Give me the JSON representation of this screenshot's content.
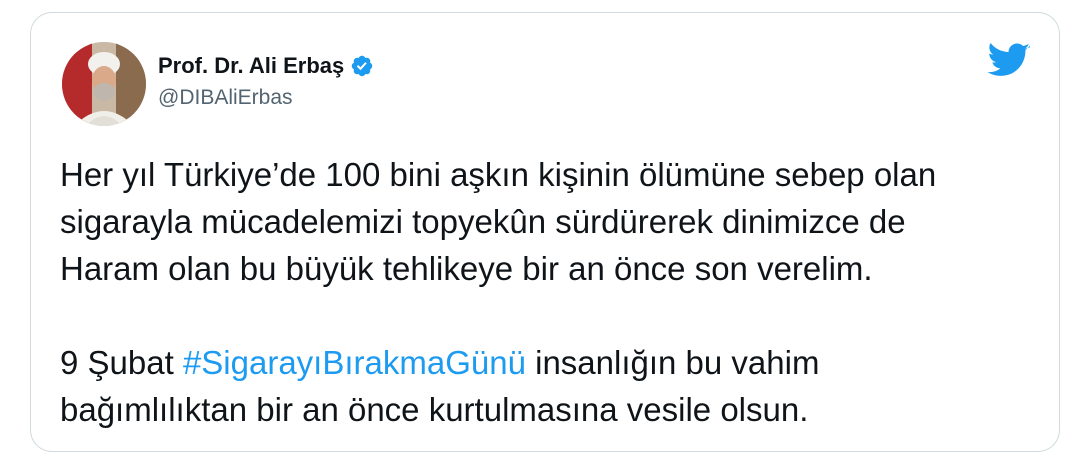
{
  "author": {
    "name": "Prof. Dr. Ali Erbaş",
    "handle": "@DIBAliErbas",
    "verified": true
  },
  "tweet": {
    "para1": [
      "Her yıl Türkiye’de 100 bini aşkın kişinin ölümüne sebep olan",
      "sigarayla mücadelemizi topyekûn sürdürerek dinimizce de",
      "Haram olan bu büyük tehlikeye bir an önce son verelim."
    ],
    "para2_prefix": "9 Şubat ",
    "hashtag": "#SigarayıBırakmaGünü",
    "para2_suffix": " insanlığın bu vahim",
    "para2_line2": "bağımlılıktan bir an önce kurtulmasına vesile olsun."
  },
  "icons": {
    "brand": "twitter-bird-icon",
    "verified": "verified-badge-icon"
  },
  "colors": {
    "accent": "#1d9bf0",
    "text": "#0f1419",
    "muted": "#536471",
    "border": "#cfd9de"
  }
}
